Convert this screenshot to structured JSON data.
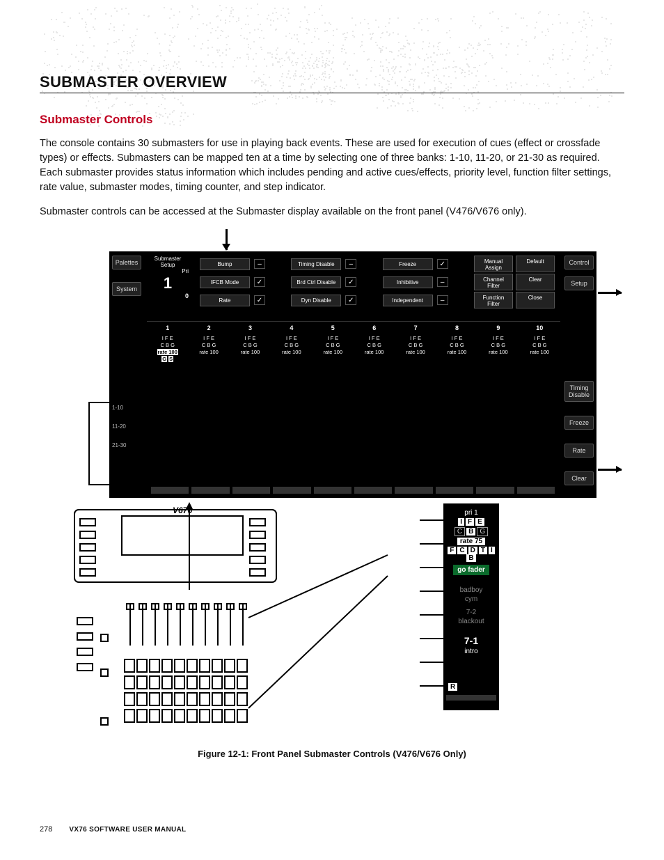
{
  "page": {
    "number": "278",
    "manual": "VX76 SOFTWARE USER MANUAL"
  },
  "headings": {
    "h1": "SUBMASTER OVERVIEW",
    "h2": "Submaster Controls"
  },
  "paragraphs": {
    "p1": "The console contains 30 submasters for use in playing back events. These are used for execution of cues (effect or crossfade types) or effects. Submasters can be mapped ten at a time by selecting one of three banks: 1-10, 11-20, or 21-30 as required. Each submaster provides status information which includes pending and active cues/effects, priority level, function filter settings, rate value, submaster modes, timing counter, and step indicator.",
    "p2": "Submaster controls can be accessed at the Submaster display available on the front panel (V476/V676 only)."
  },
  "figure_caption": "Figure 12-1:  Front Panel Submaster Controls (V476/V676 Only)",
  "screenshot": {
    "left_tabs": [
      "Palettes",
      "System"
    ],
    "setup_label": "Submaster\nSetup",
    "pri_label": "Pri",
    "setup_big": "1",
    "setup_zero": "0",
    "toggles_row1": [
      {
        "name": "Bump",
        "val": "–"
      },
      {
        "name": "Timing Disable",
        "val": "–"
      },
      {
        "name": "Freeze",
        "val": "✓"
      }
    ],
    "toggles_row2": [
      {
        "name": "IFCB Mode",
        "val": "✓"
      },
      {
        "name": "Brd Ctrl Disable",
        "val": "✓"
      },
      {
        "name": "Inhibitive",
        "val": "–"
      }
    ],
    "toggles_row3": [
      {
        "name": "Rate",
        "val": "✓"
      },
      {
        "name": "Dyn Disable",
        "val": "✓"
      },
      {
        "name": "Independent",
        "val": "–"
      }
    ],
    "right_actions_col1": [
      "Manual Assign",
      "Channel Filter",
      "Function Filter"
    ],
    "right_actions_col2": [
      "Default",
      "Clear",
      "Close"
    ],
    "right_tabs": [
      "Control",
      "Setup"
    ],
    "right_side_buttons": [
      "Timing\nDisable",
      "Freeze",
      "Rate",
      "Clear"
    ],
    "col_numbers": [
      "1",
      "2",
      "3",
      "4",
      "5",
      "6",
      "7",
      "8",
      "9",
      "10"
    ],
    "cbg_top": "I F E",
    "cbg_mid": "C B G",
    "cbg_rate": "rate 100",
    "bank_labels": [
      "1-10",
      "11-20",
      "21-30"
    ]
  },
  "detail": {
    "pri": "pri 1",
    "ife": [
      "I",
      "F",
      "E"
    ],
    "cbg": [
      "C",
      "B",
      "G"
    ],
    "rate": "rate 75",
    "fcdtib": [
      "F",
      "C",
      "D",
      "T",
      "I",
      "B"
    ],
    "go": "go fader",
    "l1": "badboy",
    "l2": "cym",
    "mid_num": "7-2",
    "mid_word": "blackout",
    "big_num": "7-1",
    "big_word": "intro",
    "corner": "R"
  },
  "console_label": "V676"
}
